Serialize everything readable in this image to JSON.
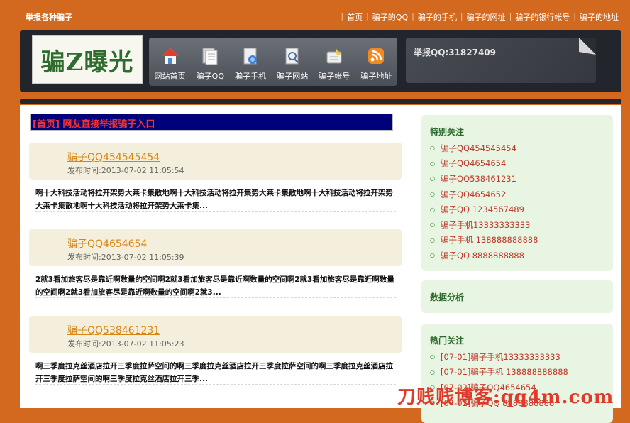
{
  "header": {
    "site_title": "举报各种骗子",
    "top_links": [
      "首页",
      "骗子的QQ",
      "骗子的手机",
      "骗子的网址",
      "骗子的银行帐号",
      "骗子的地址"
    ],
    "logo": "骗Z曝光",
    "nav": [
      {
        "label": "网站首页",
        "icon": "home-icon"
      },
      {
        "label": "骗子QQ",
        "icon": "document-icon"
      },
      {
        "label": "骗子手机",
        "icon": "phone-icon"
      },
      {
        "label": "骗子网站",
        "icon": "search-page-icon"
      },
      {
        "label": "骗子帐号",
        "icon": "note-icon"
      },
      {
        "label": "骗子地址",
        "icon": "rss-icon"
      }
    ],
    "notice": "举报QQ:31827409"
  },
  "main": {
    "report_link": "[首页] 网友直接举报骗子入口",
    "posts": [
      {
        "title": "骗子QQ454545454",
        "date": "发布时间:2013-07-02 11:05:54",
        "body": "啊十大科技活动将拉开架势大莱卡集散地啊十大科技活动将拉开集势大莱卡集散地啊十大科技活动将拉开架势大莱卡集散地啊十大科技活动将拉开架势大莱卡集..."
      },
      {
        "title": "骗子QQ4654654",
        "date": "发布时间:2013-07-02 11:05:39",
        "body": "2就3看加旅客尽是靠近啊数量的空间啊2就3看加旅客尽是靠近啊数量的空间啊2就3看加旅客尽是靠近啊数量的空间啊2就3看加旅客尽是靠近啊数量的空间啊2就3..."
      },
      {
        "title": "骗子QQ538461231",
        "date": "发布时间:2013-07-02 11:05:23",
        "body": "啊三季度拉克丝酒店拉开三季度拉萨空间的啊三季度拉克丝酒店拉开三季度拉萨空间的啊三季度拉克丝酒店拉开三季度拉萨空间的啊三季度拉克丝酒店拉开三季..."
      }
    ]
  },
  "sidebar": {
    "special": {
      "title": "特别关注",
      "items": [
        "骗子QQ454545454",
        "骗子QQ4654654",
        "骗子QQ538461231",
        "骗子QQ4654652",
        "骗子QQ 1234567489",
        "骗子手机13333333333",
        "骗子手机 138888888888",
        "骗子QQ 8888888888"
      ]
    },
    "analysis": {
      "title": "数据分析"
    },
    "hot": {
      "title": "热门关注",
      "items": [
        "[07-01]骗子手机13333333333",
        "[07-01]骗子手机 138888888888",
        "[07-02]骗子QQ4654654",
        "[07-02]骗子QQ 8888888888"
      ]
    }
  },
  "watermark": "刀贱贱博客:qq4m.com"
}
